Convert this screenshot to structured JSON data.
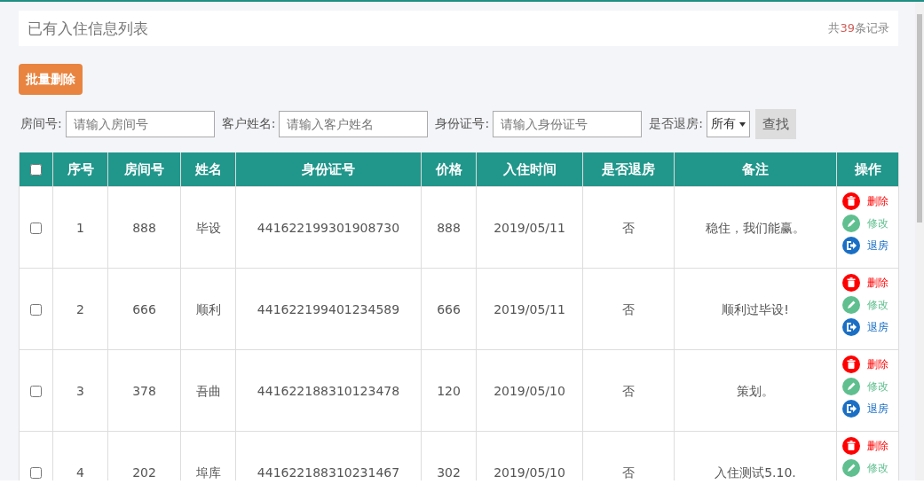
{
  "panel": {
    "title": "已有入住信息列表",
    "count_prefix": "共",
    "count": "39",
    "count_suffix": "条记录"
  },
  "batch_delete": "批量删除",
  "filters": [
    {
      "kind": "input",
      "label": "房间号:",
      "placeholder": "请输入房间号"
    },
    {
      "kind": "input",
      "label": "客户姓名:",
      "placeholder": "请输入客户姓名"
    },
    {
      "kind": "input",
      "label": "身份证号:",
      "placeholder": "请输入身份证号"
    },
    {
      "kind": "select",
      "label": "是否退房:",
      "value": "所有"
    }
  ],
  "search_button": "查找",
  "table": {
    "header_checked": false,
    "columns": [
      "序号",
      "房间号",
      "姓名",
      "身份证号",
      "价格",
      "入住时间",
      "是否退房",
      "备注",
      "操作"
    ],
    "rows": [
      {
        "checked": false,
        "cells": [
          "1",
          "888",
          "毕设",
          "441622199301908730",
          "888",
          "2019/05/11",
          "否",
          "稳住，我们能赢。"
        ],
        "actions": [
          {
            "kind": "delete",
            "label": "删除"
          },
          {
            "kind": "edit",
            "label": "修改"
          },
          {
            "kind": "checkout",
            "label": "退房"
          }
        ]
      },
      {
        "checked": false,
        "cells": [
          "2",
          "666",
          "顺利",
          "441622199401234589",
          "666",
          "2019/05/11",
          "否",
          "顺利过毕设!"
        ],
        "actions": [
          {
            "kind": "delete",
            "label": "删除"
          },
          {
            "kind": "edit",
            "label": "修改"
          },
          {
            "kind": "checkout",
            "label": "退房"
          }
        ]
      },
      {
        "checked": false,
        "cells": [
          "3",
          "378",
          "吾曲",
          "441622188310123478",
          "120",
          "2019/05/10",
          "否",
          "策划。"
        ],
        "actions": [
          {
            "kind": "delete",
            "label": "删除"
          },
          {
            "kind": "edit",
            "label": "修改"
          },
          {
            "kind": "checkout",
            "label": "退房"
          }
        ]
      },
      {
        "checked": false,
        "cells": [
          "4",
          "202",
          "埠库",
          "441622188310231467",
          "302",
          "2019/05/10",
          "否",
          "入住测试5.10."
        ],
        "actions": [
          {
            "kind": "delete",
            "label": "删除"
          },
          {
            "kind": "edit",
            "label": "修改"
          }
        ]
      }
    ]
  }
}
